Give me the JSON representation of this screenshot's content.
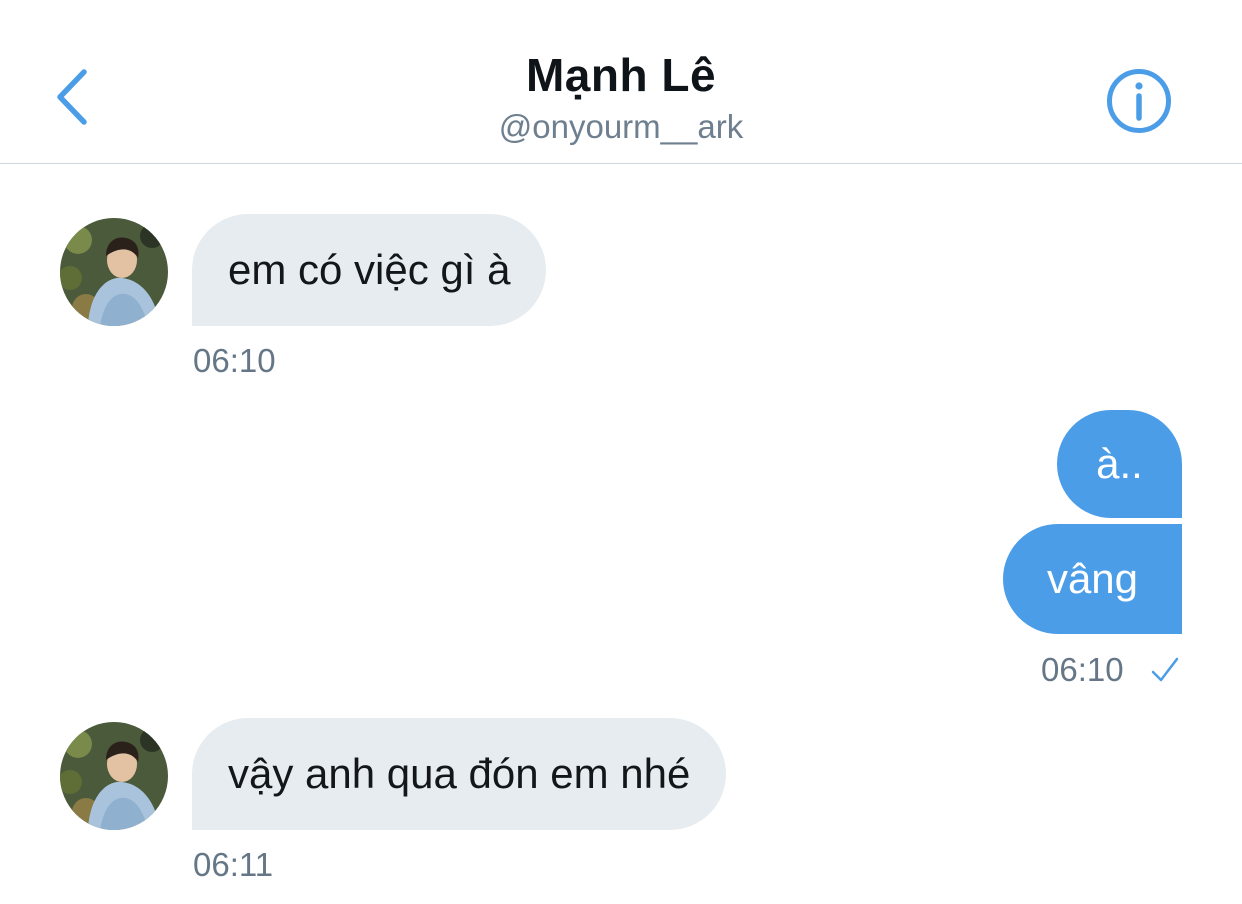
{
  "header": {
    "title": "Mạnh Lê",
    "handle": "@onyourm__ark"
  },
  "icons": {
    "back": "chevron-left-icon",
    "info": "info-circle-icon",
    "read": "checkmark-icon"
  },
  "colors": {
    "accent": "#4c9de8",
    "incoming_bubble": "#e6ecf0",
    "timestamp": "#657786"
  },
  "messages": [
    {
      "direction": "incoming",
      "text": "em có việc gì à",
      "time": "06:10"
    },
    {
      "direction": "outgoing",
      "text": "à..",
      "time": ""
    },
    {
      "direction": "outgoing",
      "text": "vâng",
      "time": "06:10"
    },
    {
      "direction": "incoming",
      "text": "vậy anh qua đón em nhé",
      "time": "06:11"
    }
  ]
}
